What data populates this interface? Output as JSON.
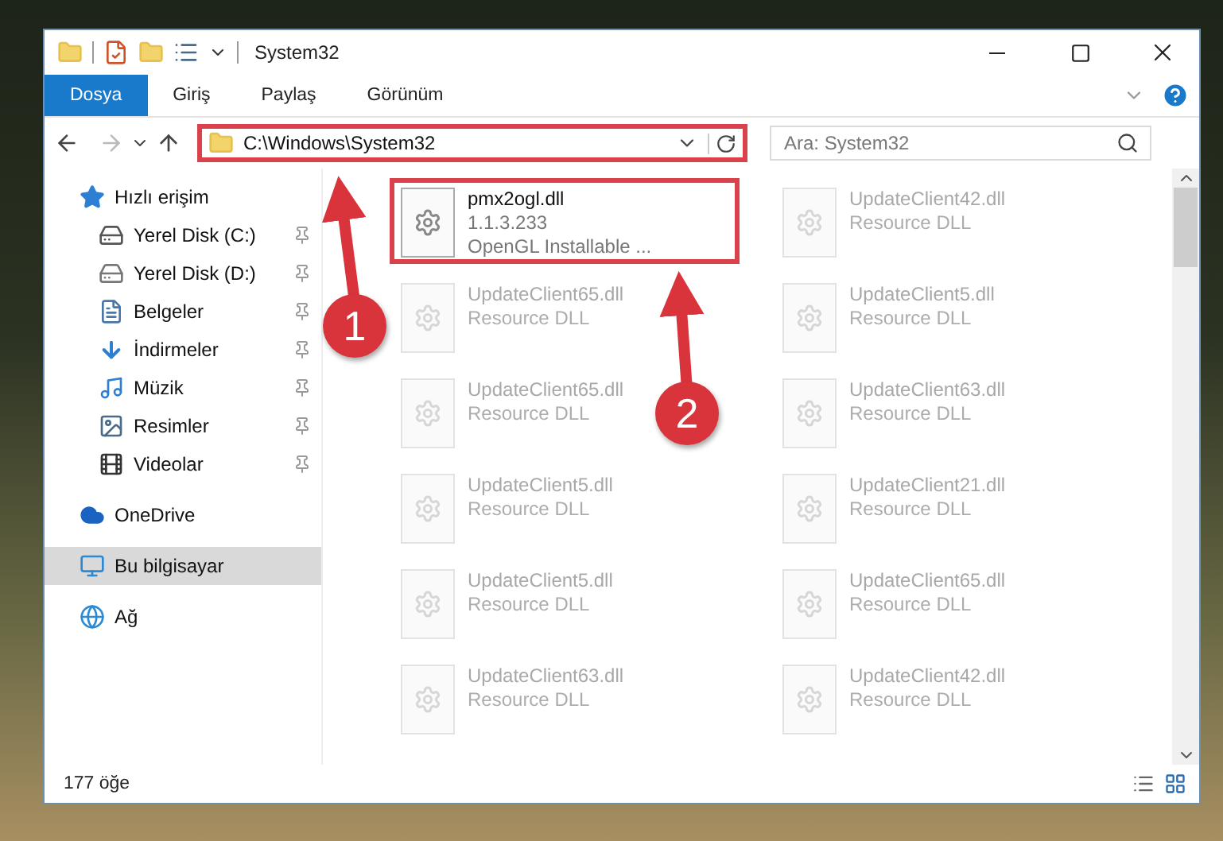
{
  "window": {
    "title": "System32"
  },
  "tabs": [
    {
      "label": "Dosya",
      "selected": true
    },
    {
      "label": "Giriş",
      "selected": false
    },
    {
      "label": "Paylaş",
      "selected": false
    },
    {
      "label": "Görünüm",
      "selected": false
    }
  ],
  "address": {
    "path": "C:\\Windows\\System32",
    "highlighted": true
  },
  "search": {
    "placeholder": "Ara: System32"
  },
  "sidebar": {
    "items": [
      {
        "label": "Hızlı erişim",
        "kind": "star",
        "selected": false,
        "children": [
          {
            "label": "Yerel Disk (C:)",
            "kind": "system-drive",
            "pinned": true,
            "selected": false
          },
          {
            "label": "Yerel Disk (D:)",
            "kind": "drive",
            "pinned": true,
            "selected": false
          },
          {
            "label": "Belgeler",
            "kind": "document",
            "pinned": true,
            "selected": false
          },
          {
            "label": "İndirmeler",
            "kind": "download",
            "pinned": true,
            "selected": false
          },
          {
            "label": "Müzik",
            "kind": "music",
            "pinned": true,
            "selected": false
          },
          {
            "label": "Resimler",
            "kind": "picture",
            "pinned": true,
            "selected": false
          },
          {
            "label": "Videolar",
            "kind": "video",
            "pinned": true,
            "selected": false
          }
        ]
      },
      {
        "label": "OneDrive",
        "kind": "cloud",
        "selected": false
      },
      {
        "label": "Bu bilgisayar",
        "kind": "computer",
        "selected": true
      },
      {
        "label": "Ağ",
        "kind": "network",
        "selected": false
      }
    ]
  },
  "files": [
    {
      "name": "pmx2ogl.dll",
      "lines": [
        "1.1.3.233",
        "OpenGL Installable ..."
      ],
      "faded": false,
      "highlighted": true
    },
    {
      "name": "UpdateClient42.dll",
      "lines": [
        "Resource DLL"
      ],
      "faded": true,
      "highlighted": false
    },
    {
      "name": "UpdateClient65.dll",
      "lines": [
        "Resource DLL"
      ],
      "faded": true,
      "highlighted": false
    },
    {
      "name": "UpdateClient5.dll",
      "lines": [
        "Resource DLL"
      ],
      "faded": true,
      "highlighted": false
    },
    {
      "name": "UpdateClient65.dll",
      "lines": [
        "Resource DLL"
      ],
      "faded": true,
      "highlighted": false
    },
    {
      "name": "UpdateClient63.dll",
      "lines": [
        "Resource DLL"
      ],
      "faded": true,
      "highlighted": false
    },
    {
      "name": "UpdateClient5.dll",
      "lines": [
        "Resource DLL"
      ],
      "faded": true,
      "highlighted": false
    },
    {
      "name": "UpdateClient21.dll",
      "lines": [
        "Resource DLL"
      ],
      "faded": true,
      "highlighted": false
    },
    {
      "name": "UpdateClient5.dll",
      "lines": [
        "Resource DLL"
      ],
      "faded": true,
      "highlighted": false
    },
    {
      "name": "UpdateClient65.dll",
      "lines": [
        "Resource DLL"
      ],
      "faded": true,
      "highlighted": false
    },
    {
      "name": "UpdateClient63.dll",
      "lines": [
        "Resource DLL"
      ],
      "faded": true,
      "highlighted": false
    },
    {
      "name": "UpdateClient42.dll",
      "lines": [
        "Resource DLL"
      ],
      "faded": true,
      "highlighted": false
    }
  ],
  "status_bar": {
    "count": "177 öğe"
  },
  "annotations": [
    {
      "label": "1"
    },
    {
      "label": "2"
    }
  ]
}
